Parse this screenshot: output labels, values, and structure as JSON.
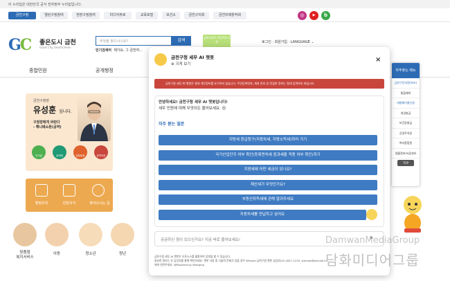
{
  "notice": {
    "text": "이 누리집은 대한민국 공식 전자정부 누리집입니다."
  },
  "topnav": {
    "items": [
      "금천구청",
      "열린구정참여",
      "현장구정참여",
      "미디어뷰로",
      "교육포털",
      "보건소",
      "금천구의회",
      "금천미래창작회"
    ]
  },
  "sns": [
    {
      "name": "instagram-icon",
      "glyph": "◎",
      "color": "#c13584"
    },
    {
      "name": "youtube-icon",
      "glyph": "▶",
      "color": "#e02020"
    },
    {
      "name": "blog-icon",
      "glyph": "b",
      "color": "#3aa84a"
    }
  ],
  "logo": {
    "mark_a": "G",
    "mark_b": "C",
    "name": "좋은도시 금천",
    "sub": "Good City GeumCheon"
  },
  "search": {
    "placeholder": "무엇을 찾으시나요?",
    "button": "검색",
    "hot_label": "인기검색어",
    "hot_words": "재가요, 그 금천하..."
  },
  "banner": {
    "text": "금천스마트 어린이도서관"
  },
  "utility": {
    "login": "로그인",
    "join": "회원가입",
    "language": "LANGUAGE"
  },
  "menu": {
    "items": [
      "종합민원",
      "공개행정"
    ]
  },
  "mayor": {
    "sub": "금천구청장",
    "name": "유성훈",
    "suffix": "입니다.",
    "line1": "구청장에게 바란다",
    "line2": "- 해니베소톤(공약)",
    "circles": [
      "인사말",
      "공개계",
      "일정동정",
      "공약자료"
    ]
  },
  "quick": {
    "items": [
      "행정조직",
      "민원서식",
      "찾아오시는 길"
    ]
  },
  "people": [
    {
      "label": "맞춤형\n복지서비스"
    },
    {
      "label": "아동"
    },
    {
      "label": "청소년"
    },
    {
      "label": "청년"
    }
  ],
  "right_side": {
    "head": "자주찾는 메뉴",
    "items": [
      "금천구민지원(보조)",
      "통합예약",
      "대형폐기물신청",
      "여권발급",
      "보건증발급",
      "공영주차장",
      "복지종합관",
      "생활정보/서류센터"
    ],
    "top": "TOP"
  },
  "chat": {
    "title": "금천구청 세무 AI 챗봇",
    "expand": "크게 보기",
    "warning": "금천구청 세무 AI 챗봇은 절대 개인정보를 요구하지 않습니다. 주민등록번호, 계좌 번호 등 민감한 정보는 절대 입력하지 마십시오.",
    "greeting_1": "안녕하세요! 금천구청 세무 AI 챗봇입니다!",
    "greeting_2": "세무 민원에 대해 무엇이든 물어보세요. 😊",
    "faq_title": "자주 묻는 질문",
    "questions": [
      "지방세 환급청구(자동차세, 지방소득세)하러 가기",
      "국가산업단지 여부 확인(등록면허세 중과세율 적용 여부 확인)하기",
      "지방세에 어떤 세금이 있나요?",
      "재산세가 무엇인가요?",
      "부동산취득세에 관해 알려주세요",
      "자동차세를 연납하고 싶어요"
    ],
    "input_placeholder": "궁금하신 점이 있으신가요? 지금 바로 물어보세요!",
    "footer_1": "금천구청 세무 AI 챗봇은 오픈소스를 활용하여 답변을 할 수 있습니다.",
    "footer_2": "중요한 정보는 유 담당자를 통해 확인하세요. 챗봇 사용 중 기술적 문제가 있을 경우 Wiscoai 금천구청 챗봇 상담자(02-2627-1234, wiscoai@wiscoai.kr)",
    "footer_3": "에게 연락주세요. @Powered by Wiroging"
  },
  "watermark": {
    "en": "DamwanMediaGroup",
    "ko": "담화미디어그룹"
  },
  "colors": {
    "primary": "#2d6bb5",
    "button": "#3f7bc2",
    "warning": "#c9463d",
    "panel": "#fbe7d0",
    "quick": "#eda950"
  }
}
